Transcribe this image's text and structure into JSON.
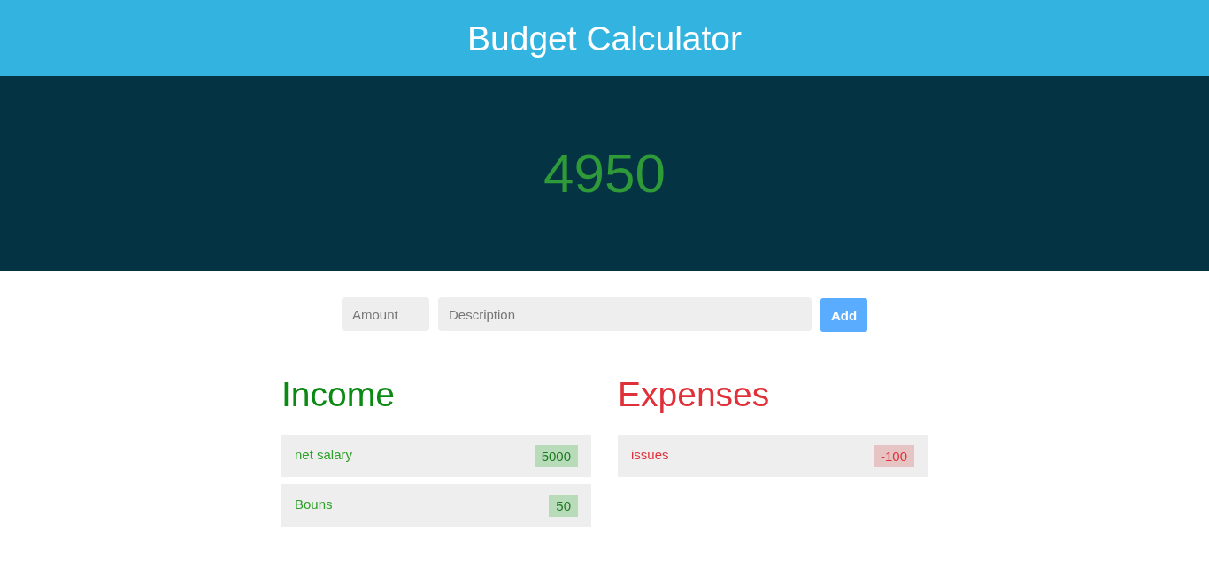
{
  "header": {
    "title": "Budget Calculator"
  },
  "balance": {
    "value": "4950"
  },
  "form": {
    "amount": {
      "placeholder": "Amount"
    },
    "description": {
      "placeholder": "Description"
    },
    "add_button": "Add"
  },
  "columns": [
    {
      "kind": "income",
      "title": "Income",
      "items": [
        {
          "description": "net salary",
          "amount": "5000"
        },
        {
          "description": "Bouns",
          "amount": "50"
        }
      ]
    },
    {
      "kind": "expense",
      "title": "Expenses",
      "items": [
        {
          "description": "issues",
          "amount": "-100"
        }
      ]
    }
  ]
}
